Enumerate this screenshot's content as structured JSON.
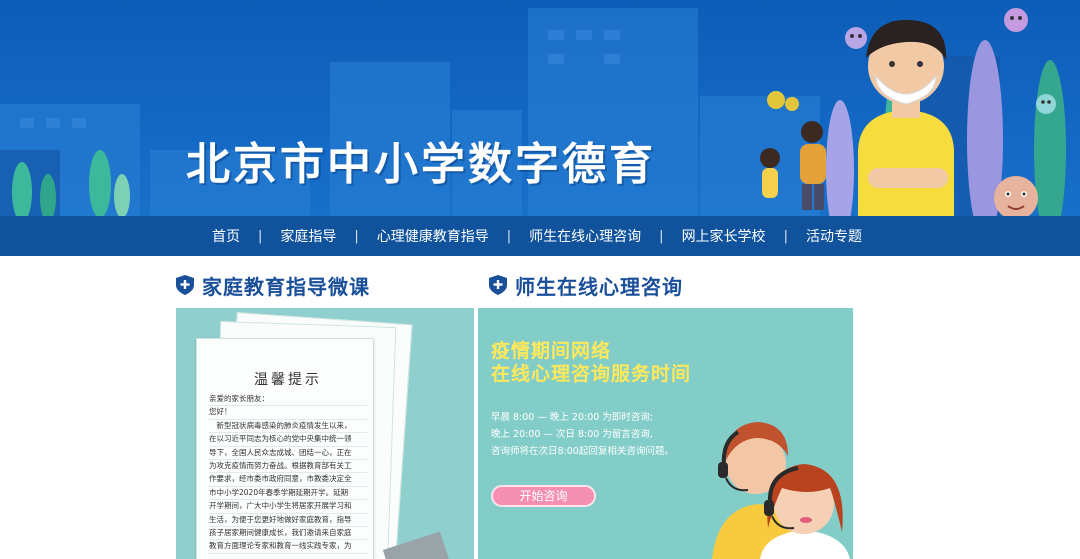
{
  "header": {
    "site_title": "北京市中小学数字德育"
  },
  "nav": {
    "items": [
      "首页",
      "家庭指导",
      "心理健康教育指导",
      "师生在线心理咨询",
      "网上家长学校",
      "活动专题"
    ],
    "separator": "|"
  },
  "sections": {
    "family": {
      "title": "家庭教育指导微课"
    },
    "counsel": {
      "title": "师生在线心理咨询"
    }
  },
  "family_card": {
    "notice_title": "温馨提示",
    "lines": [
      "亲爱的家长朋友：",
      "您好！",
      "　新型冠状病毒感染的肺炎疫情发生以来，",
      "在以习近平同志为核心的党中央集中统一领",
      "导下，全国人民众志成城、团结一心，正在",
      "为攻克疫情而努力奋战。根据教育部有关工",
      "作要求，经市委市政府同意，市教委决定全",
      "市中小学2020年春季学期延期开学。延期",
      "开学期间，广大中小学生将居家开展学习和",
      "生活，为便于您更好地做好家庭教育，指导",
      "孩子居家期间健康成长，我们邀请来自家庭",
      "教育方面理论专家和教育一线实践专家，为"
    ]
  },
  "counsel_card": {
    "title_line1": "疫情期间网络",
    "title_line2": "在线心理咨询服务时间",
    "schedule": [
      "早晨 8:00 — 晚上 20:00 为即时咨询;",
      "晚上 20:00 — 次日 8:00 为留言咨询,",
      "咨询师将在次日8:00起回复相关咨询问题。"
    ],
    "button_label": "开始咨询"
  },
  "colors": {
    "banner_blue": "#1469c4",
    "nav_bar": "#10539c",
    "heading_blue": "#1a4f99",
    "teal_card": "#83cdc9",
    "yellow_title": "#ffe95a",
    "pink_button": "#f48fb1"
  },
  "icons": [
    "shield-plus-icon",
    "virus-icon",
    "leaf-decoration-icon"
  ]
}
